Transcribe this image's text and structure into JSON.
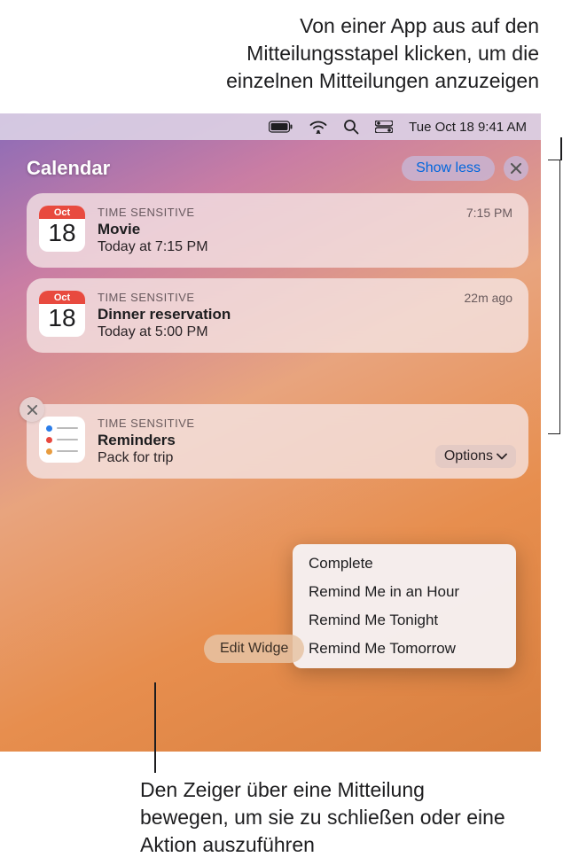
{
  "callouts": {
    "top": "Von einer App aus auf den Mitteilungsstapel klicken, um die einzelnen Mitteilungen anzuzeigen",
    "bottom": "Den Zeiger über eine Mitteilung bewegen, um sie zu schließen oder eine Aktion auszuführen"
  },
  "menubar": {
    "datetime": "Tue Oct 18  9:41 AM"
  },
  "section": {
    "title": "Calendar",
    "show_less": "Show less"
  },
  "notifications": [
    {
      "icon_month": "Oct",
      "icon_day": "18",
      "label": "TIME SENSITIVE",
      "title": "Movie",
      "subtitle": "Today at 7:15 PM",
      "time": "7:15 PM"
    },
    {
      "icon_month": "Oct",
      "icon_day": "18",
      "label": "TIME SENSITIVE",
      "title": "Dinner reservation",
      "subtitle": "Today at 5:00 PM",
      "time": "22m ago"
    }
  ],
  "reminders": {
    "label": "TIME SENSITIVE",
    "title": "Reminders",
    "subtitle": "Pack for trip",
    "options_label": "Options"
  },
  "menu": {
    "items": [
      "Complete",
      "Remind Me in an Hour",
      "Remind Me Tonight",
      "Remind Me Tomorrow"
    ]
  },
  "edit_widgets": "Edit Widge"
}
